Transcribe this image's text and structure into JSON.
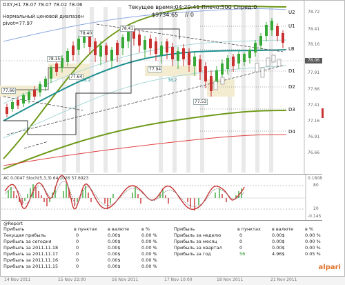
{
  "chart": {
    "symbol_line": "DXY,H1  78.07 78.07 78.02 78.06",
    "pivot_label1": "Нормальный ценовой диапазон",
    "pivot_label2": "pivot=77.97",
    "balance": "$9734.65",
    "balance_suffix": "// 0",
    "server_info": "Текущее время:04:29:41 Плечо:500 Спред:0",
    "current_price": "78.06",
    "levels": [
      "U2",
      "U1",
      "LB",
      "D1",
      "D2",
      "D3",
      "D4"
    ],
    "right_ticks": [
      "78.72",
      "78.41",
      "78.16",
      "77.91",
      "77.66",
      "77.41",
      "77.16",
      "76.91",
      "76.66"
    ],
    "price_boxes": [
      "78.40",
      "78.41",
      "78.15",
      "77.64",
      "77.94",
      "77.66",
      "77.53"
    ],
    "small_labels": [
      "38.2",
      "38.2"
    ],
    "colors": {
      "bull": "#37a937",
      "bear": "#c93030",
      "mid": "#1e8f8f",
      "envelope": "#7aa51e",
      "accent": "#e0722a"
    }
  },
  "indicator": {
    "label": "AC 0.0047  Stoch(5,3,3) 64.1026 57.6923",
    "ticks": [
      "0.1808",
      "80",
      "20",
      "-0.145"
    ]
  },
  "report": {
    "header": "@Report",
    "left_cols": [
      "Прибыль",
      "в пунктах",
      "в валюте",
      "в %"
    ],
    "left_rows": [
      [
        "Текущая прибыль",
        "0",
        "0.00$",
        "0.00 %"
      ],
      [
        "Прибыль за сегодня",
        "0",
        "0.00$",
        "0.00 %"
      ],
      [
        "Прибыль за 2011.11.18",
        "0",
        "0.00$",
        "0.00 %"
      ],
      [
        "Прибыль за 2011.11.17",
        "0",
        "0.00$",
        "0.00 %"
      ],
      [
        "Прибыль за 2011.11.16",
        "0",
        "0.00$",
        "0.00 %"
      ],
      [
        "Прибыль за 2011.11.15",
        "0",
        "0.00$",
        "0.00 %"
      ]
    ],
    "right_cols": [
      "Прибыль",
      "в пунктах",
      "в валюте",
      "в %"
    ],
    "right_rows": [
      [
        "Прибыль за неделю",
        "0",
        "0.00$",
        "0.00 %"
      ],
      [
        "Прибыль за месяц",
        "0",
        "0.00$",
        "0.00 %"
      ],
      [
        "Прибыль за квартал",
        "0",
        "0.00$",
        "0.00 %"
      ],
      [
        "Прибыль за год",
        "56",
        "4.96$",
        "0.05 %"
      ]
    ],
    "brand": "alpari"
  },
  "time_axis": [
    "14 Nov 2011",
    "15 Nov 22:00",
    "16 Nov 2011",
    "17 Nov 10:00",
    "18 Nov 2011",
    "21 Nov 2011"
  ]
}
